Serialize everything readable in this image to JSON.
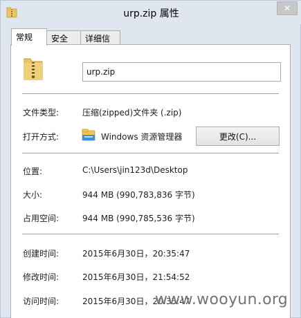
{
  "window": {
    "title": "urp.zip 属性",
    "close_glyph": "✕"
  },
  "tabs": [
    {
      "label": "常规",
      "active": true
    },
    {
      "label": "安全",
      "active": false
    },
    {
      "label": "详细信息",
      "active": false
    }
  ],
  "general": {
    "filename": "urp.zip",
    "file_type_label": "文件类型:",
    "file_type_value": "压缩(zipped)文件夹 (.zip)",
    "opens_with_label": "打开方式:",
    "opens_with_value": "Windows 资源管理器",
    "change_button": "更改(C)...",
    "location_label": "位置:",
    "location_value": "C:\\Users\\jin123d\\Desktop",
    "size_label": "大小:",
    "size_value": "944 MB (990,783,836 字节)",
    "size_on_disk_label": "占用空间:",
    "size_on_disk_value": "944 MB (990,785,536 字节)",
    "created_label": "创建时间:",
    "created_value": "2015年6月30日，20:35:47",
    "modified_label": "修改时间:",
    "modified_value": "2015年6月30日，21:54:52",
    "accessed_label": "访问时间:",
    "accessed_value": "2015年6月30日，20:35:47"
  },
  "watermark": "www.wooyun.org",
  "icons": {
    "title": "zip-folder-icon",
    "file": "zip-folder-icon",
    "opens_with": "explorer-icon"
  },
  "colors": {
    "frame": "#dfe6ef",
    "panel": "#ffffff",
    "folder": "#e9c565"
  }
}
